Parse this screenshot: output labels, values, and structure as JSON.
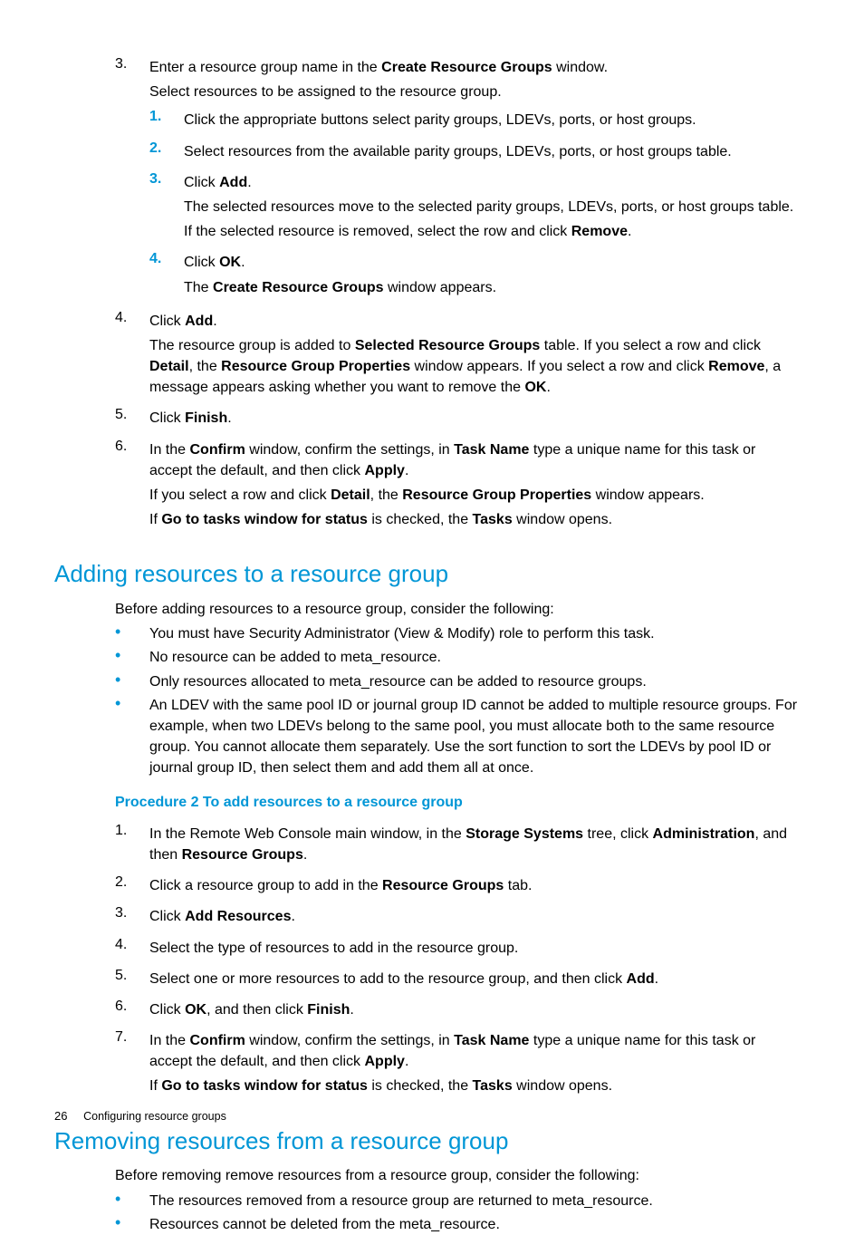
{
  "step3_main": "Enter a resource group name in the <b>Create Resource Groups</b> window.",
  "step3_p1": "Select resources to be assigned to the resource group.",
  "sub1": "Click the appropriate buttons select parity groups, LDEVs, ports, or host groups.",
  "sub2": "Select resources from the available parity groups, LDEVs, ports, or host groups table.",
  "sub3": "Click <b>Add</b>.",
  "sub3_p1": "The selected resources move to the selected parity groups, LDEVs, ports, or host groups table.",
  "sub3_p2": "If the selected resource is removed, select the row and click <b>Remove</b>.",
  "sub4": "Click <b>OK</b>.",
  "sub4_p1": "The <b>Create Resource Groups</b> window appears.",
  "step4": "Click <b>Add</b>.",
  "step4_p1": "The resource group is added to <b>Selected Resource Groups</b> table. If you select a row and click <b>Detail</b>, the <b>Resource Group Properties</b> window appears. If you select a row and click <b>Remove</b>, a message appears asking whether you want to remove the <b>OK</b>.",
  "step5": "Click <b>Finish</b>.",
  "step6": "In the <b>Confirm</b> window, confirm the settings, in <b>Task Name</b> type a unique name for this task or accept the default, and then click <b>Apply</b>.",
  "step6_p1": "If you select a row and click <b>Detail</b>, the <b>Resource Group Properties</b> window appears.",
  "step6_p2": "If <b>Go to tasks window for status</b> is checked, the <b>Tasks</b> window opens.",
  "h2_adding": "Adding resources to a resource group",
  "adding_intro": "Before adding resources to a resource group, consider the following:",
  "add_b1": "You must have Security Administrator (View & Modify) role to perform this task.",
  "add_b2": "No resource can be added to meta_resource.",
  "add_b3": "Only resources allocated to meta_resource can be added to resource groups.",
  "add_b4": "An LDEV with the same pool ID or journal group ID cannot be added to multiple resource groups. For example, when two LDEVs belong to the same pool, you must allocate both to the same resource group. You cannot allocate them separately. Use the sort function to sort the LDEVs by pool ID or journal group ID, then select them and add them all at once.",
  "proc2_title": "Procedure 2 To add resources to a resource group",
  "p2_1": "In the Remote Web Console main window, in the <b>Storage Systems</b> tree, click <b>Administration</b>, and then <b>Resource Groups</b>.",
  "p2_2": "Click a resource group to add in the <b>Resource Groups</b> tab.",
  "p2_3": "Click <b>Add Resources</b>.",
  "p2_4": "Select the type of resources to add in the resource group.",
  "p2_5": "Select one or more resources to add to the resource group, and then click <b>Add</b>.",
  "p2_6": "Click <b>OK</b>, and then click <b>Finish</b>.",
  "p2_7": "In the <b>Confirm</b> window, confirm the settings, in <b>Task Name</b> type a unique name for this task or accept the default, and then click <b>Apply</b>.",
  "p2_7_p1": "If <b>Go to tasks window for status</b> is checked, the <b>Tasks</b> window opens.",
  "h2_removing": "Removing resources from a resource group",
  "removing_intro": "Before removing remove resources from a resource group, consider the following:",
  "rem_b1": "The resources removed from a resource group are returned to meta_resource.",
  "rem_b2": "Resources cannot be deleted from the meta_resource.",
  "footer_page": "26",
  "footer_chapter": "Configuring resource groups"
}
